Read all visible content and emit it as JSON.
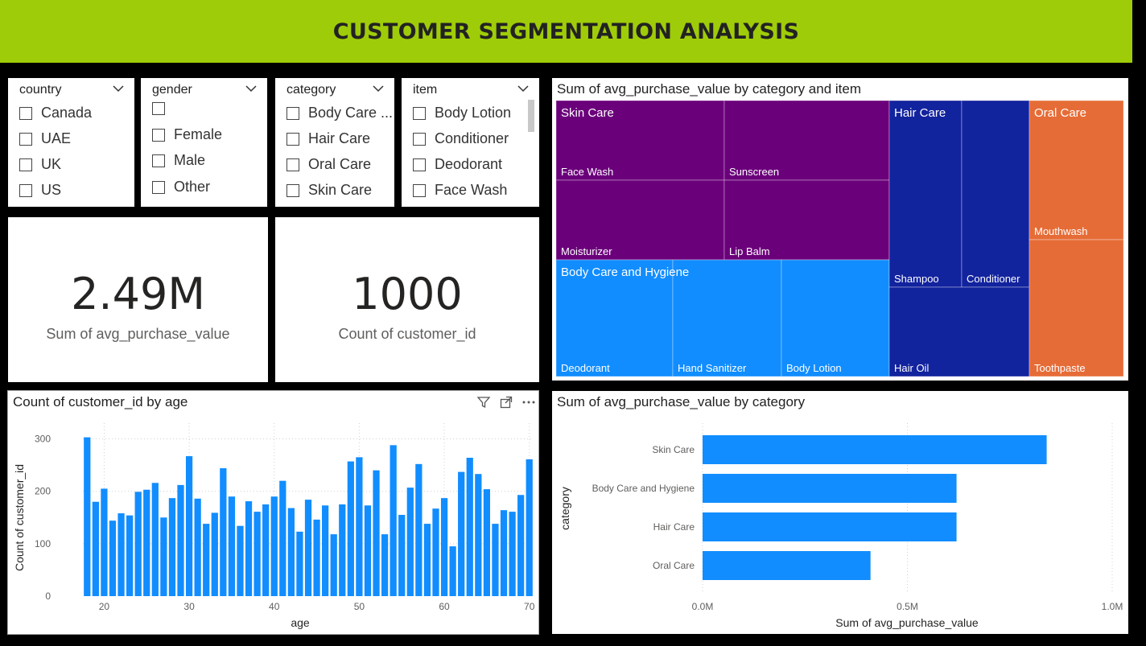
{
  "header": {
    "title": "CUSTOMER SEGMENTATION ANALYSIS"
  },
  "slicers": {
    "country": {
      "title": "country",
      "options": [
        "Canada",
        "UAE",
        "UK",
        "US"
      ]
    },
    "gender": {
      "title": "gender",
      "options": [
        "",
        "Female",
        "Male",
        "Other"
      ]
    },
    "category": {
      "title": "category",
      "options": [
        "Body Care ...",
        "Hair Care",
        "Oral Care",
        "Skin Care"
      ]
    },
    "item": {
      "title": "item",
      "options": [
        "Body Lotion",
        "Conditioner",
        "Deodorant",
        "Face Wash"
      ]
    }
  },
  "kpis": {
    "purchase": {
      "value": "2.49M",
      "label": "Sum of avg_purchase_value"
    },
    "customers": {
      "value": "1000",
      "label": "Count of customer_id"
    }
  },
  "treemap": {
    "title": "Sum of avg_purchase_value by category and item",
    "colors": {
      "Skin Care": "#6b007b",
      "Body Care and Hygiene": "#118dff",
      "Hair Care": "#12239e",
      "Oral Care": "#e66c37"
    },
    "categories": [
      {
        "name": "Skin Care",
        "items": [
          "Face Wash",
          "Sunscreen",
          "Moisturizer",
          "Lip Balm"
        ]
      },
      {
        "name": "Body Care and Hygiene",
        "items": [
          "Deodorant",
          "Hand Sanitizer",
          "Body Lotion"
        ]
      },
      {
        "name": "Hair Care",
        "items": [
          "Shampoo",
          "Conditioner",
          "Hair Oil"
        ]
      },
      {
        "name": "Oral Care",
        "items": [
          "Mouthwash",
          "Toothpaste"
        ]
      }
    ]
  },
  "age_chart": {
    "title": "Count of customer_id by age",
    "icons": [
      "filter-icon",
      "focus-mode-icon",
      "more-options-icon"
    ]
  },
  "category_chart": {
    "title": "Sum of avg_purchase_value by category"
  },
  "chart_data": [
    {
      "type": "bar",
      "title": "Count of customer_id by age",
      "xlabel": "age",
      "ylabel": "Count of customer_id",
      "x": [
        18,
        19,
        20,
        21,
        22,
        23,
        24,
        25,
        26,
        27,
        28,
        29,
        30,
        31,
        32,
        33,
        34,
        35,
        36,
        37,
        38,
        39,
        40,
        41,
        42,
        43,
        44,
        45,
        46,
        47,
        48,
        49,
        50,
        51,
        52,
        53,
        54,
        55,
        56,
        57,
        58,
        59,
        60,
        61,
        62,
        63,
        64,
        65,
        66,
        67,
        68,
        69,
        70
      ],
      "values": [
        303,
        180,
        205,
        144,
        158,
        154,
        199,
        203,
        216,
        150,
        187,
        212,
        267,
        186,
        138,
        159,
        244,
        190,
        134,
        181,
        161,
        175,
        190,
        220,
        168,
        123,
        184,
        146,
        173,
        118,
        175,
        257,
        265,
        173,
        240,
        118,
        288,
        155,
        207,
        252,
        138,
        167,
        187,
        95,
        237,
        264,
        233,
        204,
        138,
        164,
        161,
        193,
        261
      ],
      "xticks": [
        20,
        30,
        40,
        50,
        60,
        70
      ],
      "yticks": [
        0,
        100,
        200,
        300
      ],
      "ylim": [
        0,
        330
      ],
      "grid": true,
      "color": "#118dff"
    },
    {
      "type": "bar",
      "orientation": "horizontal",
      "title": "Sum of avg_purchase_value by category",
      "xlabel": "Sum of avg_purchase_value",
      "ylabel": "category",
      "categories": [
        "Skin Care",
        "Body Care and Hygiene",
        "Hair Care",
        "Oral Care"
      ],
      "values": [
        0.84,
        0.62,
        0.62,
        0.41
      ],
      "xticks": [
        "0.0M",
        "0.5M",
        "1.0M"
      ],
      "xlim": [
        0,
        1.0
      ],
      "unit": "M",
      "color": "#118dff"
    }
  ]
}
